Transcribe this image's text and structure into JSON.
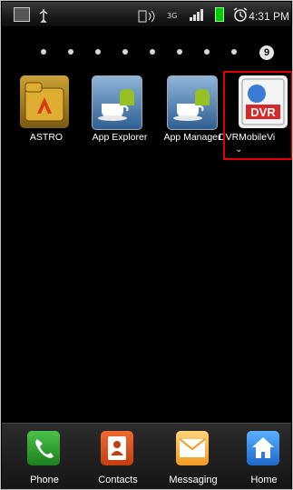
{
  "status_bar": {
    "time": "4:31 PM",
    "network": "3G",
    "icons": [
      "image-icon",
      "usb-icon",
      "nfc-icon",
      "3g-icon",
      "signal-icon",
      "battery-icon",
      "alarm-icon"
    ]
  },
  "home_screen": {
    "page_indicator": {
      "current_page": "9",
      "total_dots": 9
    },
    "apps": [
      {
        "label": "ASTRO",
        "icon": "folder-icon"
      },
      {
        "label": "App Explorer",
        "icon": "coffee-android-icon"
      },
      {
        "label": "App Manager",
        "icon": "coffee-android-icon"
      },
      {
        "label": "DVRMobileVi",
        "icon": "dvr-icon",
        "highlighted": true
      }
    ]
  },
  "dock": {
    "items": [
      {
        "label": "Phone",
        "icon": "phone-icon"
      },
      {
        "label": "Contacts",
        "icon": "contacts-icon"
      },
      {
        "label": "Messaging",
        "icon": "messaging-icon"
      },
      {
        "label": "Home",
        "icon": "home-icon"
      }
    ]
  },
  "colors": {
    "background": "#000000",
    "highlight": "#e00000"
  }
}
